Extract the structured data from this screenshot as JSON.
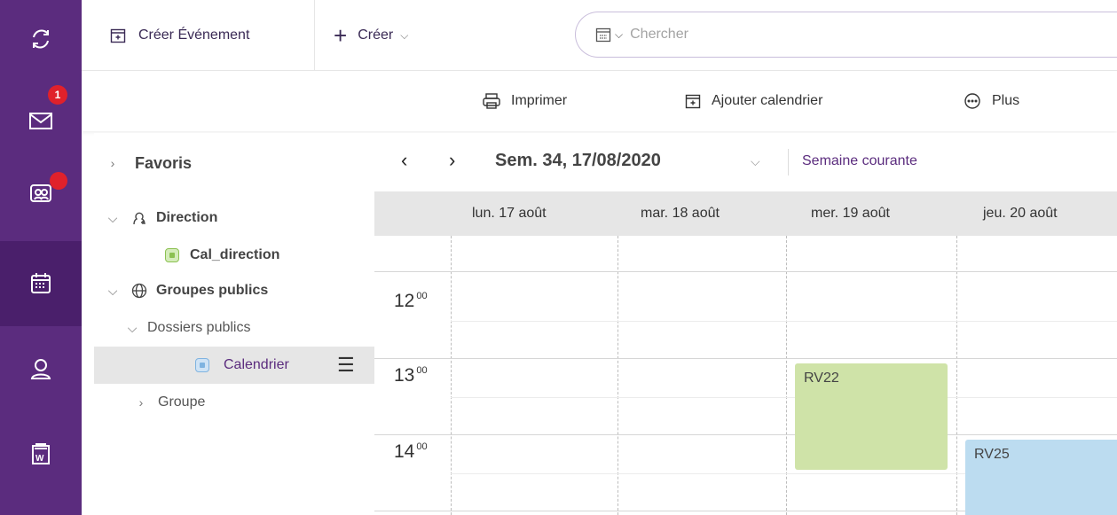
{
  "rail": {
    "mail_badge": "1"
  },
  "toolbar": {
    "create_event_label": "Créer Événement",
    "create_label": "Créer",
    "search_placeholder": "Chercher"
  },
  "subtoolbar": {
    "print_label": "Imprimer",
    "add_calendar_label": "Ajouter calendrier",
    "more_label": "Plus"
  },
  "tree": {
    "favorites": "Favoris",
    "direction": "Direction",
    "cal_direction": "Cal_direction",
    "public_groups": "Groupes publics",
    "public_folders": "Dossiers publics",
    "calendar": "Calendrier",
    "group": "Groupe"
  },
  "calendar": {
    "week_label": "Sem. 34, 17/08/2020",
    "current_week": "Semaine courante",
    "days": [
      "lun. 17 août",
      "mar. 18 août",
      "mer. 19 août",
      "jeu. 20 août"
    ],
    "hours": [
      "12",
      "13",
      "14"
    ],
    "hour_minutes": "00",
    "events": [
      {
        "title": "RV22",
        "color": "#cfe3a8"
      },
      {
        "title": "RV25",
        "color": "#bcdcf0"
      }
    ]
  },
  "colors": {
    "rail": "#5b2c7e",
    "accent": "#5b2c7e",
    "badge": "#e0212b",
    "cal_direction": "#8cc152",
    "calendrier": "#7fb3e0"
  }
}
